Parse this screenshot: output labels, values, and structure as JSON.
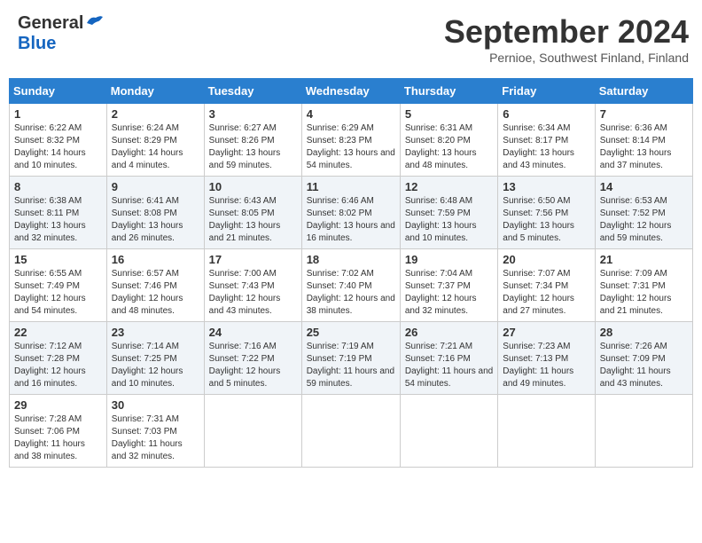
{
  "header": {
    "logo_general": "General",
    "logo_blue": "Blue",
    "month_title": "September 2024",
    "location": "Pernioe, Southwest Finland, Finland"
  },
  "days_of_week": [
    "Sunday",
    "Monday",
    "Tuesday",
    "Wednesday",
    "Thursday",
    "Friday",
    "Saturday"
  ],
  "weeks": [
    [
      {
        "day": "1",
        "sunrise": "Sunrise: 6:22 AM",
        "sunset": "Sunset: 8:32 PM",
        "daylight": "Daylight: 14 hours and 10 minutes."
      },
      {
        "day": "2",
        "sunrise": "Sunrise: 6:24 AM",
        "sunset": "Sunset: 8:29 PM",
        "daylight": "Daylight: 14 hours and 4 minutes."
      },
      {
        "day": "3",
        "sunrise": "Sunrise: 6:27 AM",
        "sunset": "Sunset: 8:26 PM",
        "daylight": "Daylight: 13 hours and 59 minutes."
      },
      {
        "day": "4",
        "sunrise": "Sunrise: 6:29 AM",
        "sunset": "Sunset: 8:23 PM",
        "daylight": "Daylight: 13 hours and 54 minutes."
      },
      {
        "day": "5",
        "sunrise": "Sunrise: 6:31 AM",
        "sunset": "Sunset: 8:20 PM",
        "daylight": "Daylight: 13 hours and 48 minutes."
      },
      {
        "day": "6",
        "sunrise": "Sunrise: 6:34 AM",
        "sunset": "Sunset: 8:17 PM",
        "daylight": "Daylight: 13 hours and 43 minutes."
      },
      {
        "day": "7",
        "sunrise": "Sunrise: 6:36 AM",
        "sunset": "Sunset: 8:14 PM",
        "daylight": "Daylight: 13 hours and 37 minutes."
      }
    ],
    [
      {
        "day": "8",
        "sunrise": "Sunrise: 6:38 AM",
        "sunset": "Sunset: 8:11 PM",
        "daylight": "Daylight: 13 hours and 32 minutes."
      },
      {
        "day": "9",
        "sunrise": "Sunrise: 6:41 AM",
        "sunset": "Sunset: 8:08 PM",
        "daylight": "Daylight: 13 hours and 26 minutes."
      },
      {
        "day": "10",
        "sunrise": "Sunrise: 6:43 AM",
        "sunset": "Sunset: 8:05 PM",
        "daylight": "Daylight: 13 hours and 21 minutes."
      },
      {
        "day": "11",
        "sunrise": "Sunrise: 6:46 AM",
        "sunset": "Sunset: 8:02 PM",
        "daylight": "Daylight: 13 hours and 16 minutes."
      },
      {
        "day": "12",
        "sunrise": "Sunrise: 6:48 AM",
        "sunset": "Sunset: 7:59 PM",
        "daylight": "Daylight: 13 hours and 10 minutes."
      },
      {
        "day": "13",
        "sunrise": "Sunrise: 6:50 AM",
        "sunset": "Sunset: 7:56 PM",
        "daylight": "Daylight: 13 hours and 5 minutes."
      },
      {
        "day": "14",
        "sunrise": "Sunrise: 6:53 AM",
        "sunset": "Sunset: 7:52 PM",
        "daylight": "Daylight: 12 hours and 59 minutes."
      }
    ],
    [
      {
        "day": "15",
        "sunrise": "Sunrise: 6:55 AM",
        "sunset": "Sunset: 7:49 PM",
        "daylight": "Daylight: 12 hours and 54 minutes."
      },
      {
        "day": "16",
        "sunrise": "Sunrise: 6:57 AM",
        "sunset": "Sunset: 7:46 PM",
        "daylight": "Daylight: 12 hours and 48 minutes."
      },
      {
        "day": "17",
        "sunrise": "Sunrise: 7:00 AM",
        "sunset": "Sunset: 7:43 PM",
        "daylight": "Daylight: 12 hours and 43 minutes."
      },
      {
        "day": "18",
        "sunrise": "Sunrise: 7:02 AM",
        "sunset": "Sunset: 7:40 PM",
        "daylight": "Daylight: 12 hours and 38 minutes."
      },
      {
        "day": "19",
        "sunrise": "Sunrise: 7:04 AM",
        "sunset": "Sunset: 7:37 PM",
        "daylight": "Daylight: 12 hours and 32 minutes."
      },
      {
        "day": "20",
        "sunrise": "Sunrise: 7:07 AM",
        "sunset": "Sunset: 7:34 PM",
        "daylight": "Daylight: 12 hours and 27 minutes."
      },
      {
        "day": "21",
        "sunrise": "Sunrise: 7:09 AM",
        "sunset": "Sunset: 7:31 PM",
        "daylight": "Daylight: 12 hours and 21 minutes."
      }
    ],
    [
      {
        "day": "22",
        "sunrise": "Sunrise: 7:12 AM",
        "sunset": "Sunset: 7:28 PM",
        "daylight": "Daylight: 12 hours and 16 minutes."
      },
      {
        "day": "23",
        "sunrise": "Sunrise: 7:14 AM",
        "sunset": "Sunset: 7:25 PM",
        "daylight": "Daylight: 12 hours and 10 minutes."
      },
      {
        "day": "24",
        "sunrise": "Sunrise: 7:16 AM",
        "sunset": "Sunset: 7:22 PM",
        "daylight": "Daylight: 12 hours and 5 minutes."
      },
      {
        "day": "25",
        "sunrise": "Sunrise: 7:19 AM",
        "sunset": "Sunset: 7:19 PM",
        "daylight": "Daylight: 11 hours and 59 minutes."
      },
      {
        "day": "26",
        "sunrise": "Sunrise: 7:21 AM",
        "sunset": "Sunset: 7:16 PM",
        "daylight": "Daylight: 11 hours and 54 minutes."
      },
      {
        "day": "27",
        "sunrise": "Sunrise: 7:23 AM",
        "sunset": "Sunset: 7:13 PM",
        "daylight": "Daylight: 11 hours and 49 minutes."
      },
      {
        "day": "28",
        "sunrise": "Sunrise: 7:26 AM",
        "sunset": "Sunset: 7:09 PM",
        "daylight": "Daylight: 11 hours and 43 minutes."
      }
    ],
    [
      {
        "day": "29",
        "sunrise": "Sunrise: 7:28 AM",
        "sunset": "Sunset: 7:06 PM",
        "daylight": "Daylight: 11 hours and 38 minutes."
      },
      {
        "day": "30",
        "sunrise": "Sunrise: 7:31 AM",
        "sunset": "Sunset: 7:03 PM",
        "daylight": "Daylight: 11 hours and 32 minutes."
      },
      null,
      null,
      null,
      null,
      null
    ]
  ]
}
